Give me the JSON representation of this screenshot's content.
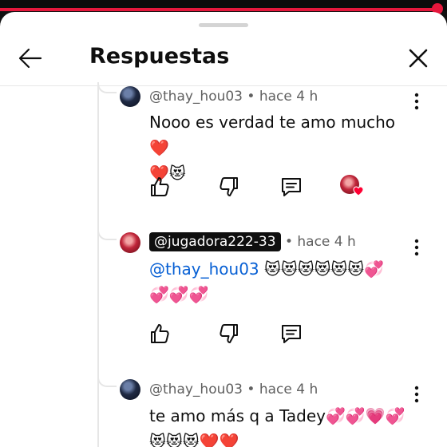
{
  "progress": {
    "value_percent": 98,
    "color": "#e5173c"
  },
  "header": {
    "title": "Respuestas"
  },
  "comments": [
    {
      "author": "@thay_hou03",
      "author_style": "plain",
      "time": "hace 4 h",
      "text": "Nooo es verdad te amo mucho❤️\n❤️😻",
      "mention": "",
      "avatar": "dark",
      "liked_by_creator": true
    },
    {
      "author": "@jugadora222-33",
      "author_style": "highlighted",
      "time": "hace 4 h",
      "mention": "@thay_hou03",
      "text": " 😻😻😻😻😻😻💞\n💞💞💞",
      "avatar": "red",
      "liked_by_creator": false
    },
    {
      "author": "@thay_hou03",
      "author_style": "plain",
      "time": "hace 4 h",
      "text": "te amo más q a Tadey💞💞💗💞\n😻😻😻❤️❤️",
      "mention": "",
      "avatar": "dark",
      "liked_by_creator": false
    }
  ],
  "separator": "•",
  "icons": {
    "back": "arrow-left-icon",
    "close": "close-icon",
    "more": "more-vertical-icon",
    "like": "thumb-up-icon",
    "dislike": "thumb-down-icon",
    "reply": "reply-comment-icon",
    "creator_heart": "creator-heart-icon"
  }
}
